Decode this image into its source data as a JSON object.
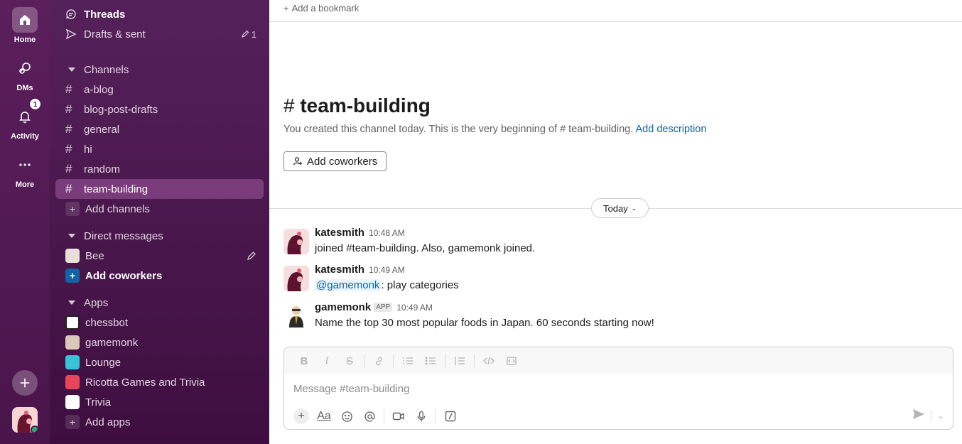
{
  "rail": {
    "home_label": "Home",
    "dms_label": "DMs",
    "activity_label": "Activity",
    "activity_badge": "1",
    "more_label": "More"
  },
  "sidebar": {
    "threads": "Threads",
    "drafts": "Drafts & sent",
    "drafts_count": "1",
    "channels_header": "Channels",
    "channels": [
      "a-blog",
      "blog-post-drafts",
      "general",
      "hi",
      "random",
      "team-building"
    ],
    "add_channels": "Add channels",
    "dm_header": "Direct messages",
    "dm_user": "Bee",
    "add_coworkers": "Add coworkers",
    "apps_header": "Apps",
    "apps": [
      "chessbot",
      "gamemonk",
      "Lounge",
      "Ricotta Games and Trivia",
      "Trivia"
    ],
    "add_apps": "Add apps"
  },
  "main": {
    "bookmark": "Add a bookmark",
    "channel_title": "team-building",
    "desc_prefix": "You created this channel today. This is the very beginning of",
    "desc_channel": "# team-building.",
    "desc_link": "Add description",
    "add_coworkers_btn": "Add coworkers",
    "today_label": "Today",
    "messages": [
      {
        "name": "katesmith",
        "time": "10:48 AM",
        "text": "joined #team-building. Also, gamemonk joined."
      },
      {
        "name": "katesmith",
        "time": "10:49 AM",
        "mention": "@gamemonk",
        "text": ": play categories"
      },
      {
        "name": "gamemonk",
        "tag": "APP",
        "time": "10:49 AM",
        "text": "Name the top 30 most popular foods in Japan. 60 seconds starting now!"
      }
    ],
    "composer_placeholder": "Message #team-building",
    "aa_label": "Aa"
  },
  "colors": {
    "sidebar_bg": "#3f0e40",
    "active_channel": "#7c3a7e",
    "link": "#1264a3",
    "presence": "#2bac76"
  }
}
